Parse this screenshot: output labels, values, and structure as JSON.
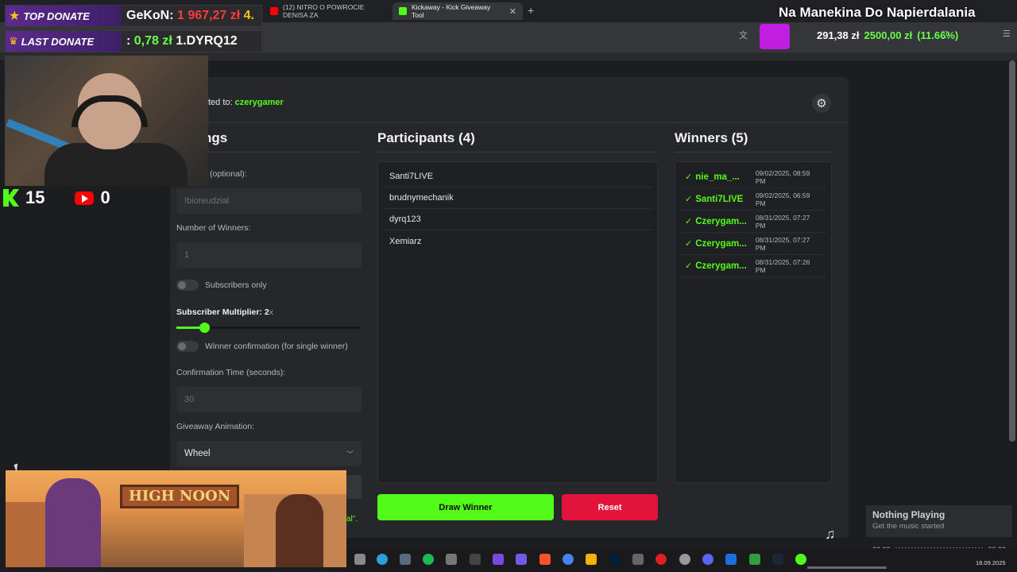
{
  "browser": {
    "tabs": [
      {
        "label": "(12) NITRO O POWROCIE DENISA ZA",
        "active": false
      },
      {
        "label": "Kickaway - Kick Giveaway Tool",
        "active": true
      }
    ]
  },
  "overlay": {
    "top_donate_label": "TOP DONATE",
    "top_donate_name": "GeKoN:",
    "top_donate_amount": "1 967,27 zł",
    "top_donate_extra": "4.",
    "last_donate_label": "LAST DONATE",
    "last_donate_prefix": ":",
    "last_donate_amount": "0,78 zł",
    "last_donate_extra": "1.DYRQ12",
    "stream_title": "Na Manekina Do Napierdalania",
    "stats_balance": "291,38 zł",
    "stats_goal": "2500,00 zł",
    "stats_percent": "(11.66%)",
    "kick_count": "15",
    "yt_count": "0",
    "game_sign": "HIGH NOON"
  },
  "app": {
    "connected_prefix": "ted to:",
    "connected_user": "czerygamer",
    "settings_title": "ngs",
    "participants_title": "Participants (4)",
    "winners_title": "Winners (5)",
    "keyword_label": "(optional):",
    "keyword_placeholder": "!bioreudzial",
    "num_winners_label": "Number of Winners:",
    "num_winners_placeholder": "1",
    "subscribers_only_label": "Subscribers only",
    "multiplier_label": "Subscriber Multiplier: 2",
    "multiplier_suffix": "x",
    "multiplier_level": 0.15,
    "winner_confirmation_label": "Winner confirmation (for single winner)",
    "confirmation_time_label": "Confirmation Time (seconds):",
    "confirmation_time_placeholder": "30",
    "animation_label": "Giveaway Animation:",
    "animation_value": "Wheel",
    "green_tail": "al\".",
    "participants": [
      "Santi7LIVE",
      "brudnymechanik",
      "dyrq123",
      "Xemiarz"
    ],
    "winners": [
      {
        "name": "nie_ma_...",
        "time": "09/02/2025, 08:59 PM"
      },
      {
        "name": "Santi7LIVE",
        "time": "09/02/2025, 06:59 PM"
      },
      {
        "name": "Czerygam...",
        "time": "08/31/2025, 07:27 PM"
      },
      {
        "name": "Czerygam...",
        "time": "08/31/2025, 07:27 PM"
      },
      {
        "name": "Czerygam...",
        "time": "08/31/2025, 07:26 PM"
      }
    ],
    "draw_button": "Draw Winner",
    "reset_button": "Reset"
  },
  "music": {
    "title": "Nothing Playing",
    "subtitle": "Get the music started",
    "time_start": "00:00",
    "time_end": "00:00"
  },
  "taskbar": {
    "date": "18.09.2025"
  },
  "colors": {
    "accent": "#53fc18",
    "danger": "#e2143c",
    "background": "#1c1d20"
  }
}
